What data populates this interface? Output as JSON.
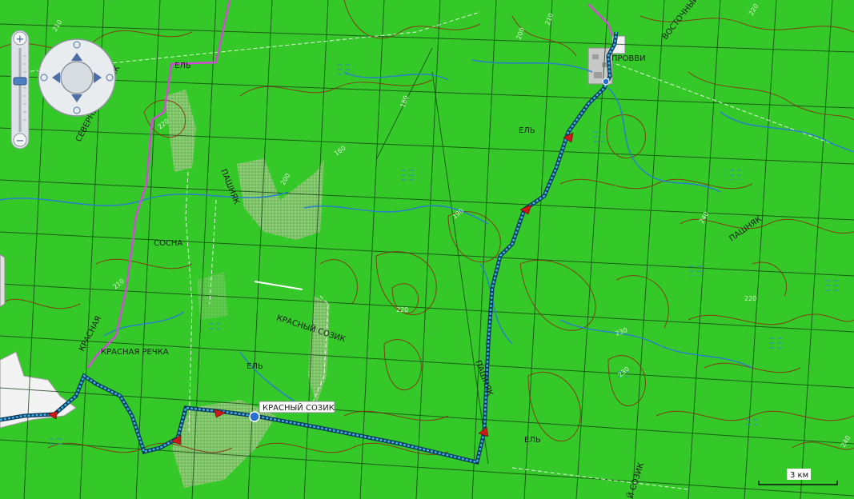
{
  "map": {
    "background_color": "#34c928",
    "route_color": "#1f9ad6",
    "road_color": "#d24bd6",
    "contour_color": "#8a2a10"
  },
  "places": {
    "provvi": "ПРОВВИ",
    "vostochny": "ВОСТОЧНЫЙ",
    "krasny_sozik": "КРАСНЫЙ СОЗИК",
    "krasny_sozik_river": "КРАСНЫЙ СОЗИК",
    "krasnaya_rechka": "КРАСНАЯ РЕЧКА",
    "krasnaya": "КРАСНАЯ",
    "sosna": "СОСНА",
    "el_1": "ЕЛЬ",
    "el_2": "ЕЛЬ",
    "el_3": "ЕЛЬ",
    "el_4": "ЕЛЬ",
    "pashnyak_1": "ПАШНЯК",
    "pashnyak_2": "ПАШНЯК",
    "pashnyak_3": "ПАШНЯК",
    "sozik_bottom": "Й СОЗИК",
    "severny": "СЕВЕРНЫЙ ПАШНЯК"
  },
  "contour_labels": [
    "210",
    "220",
    "200",
    "160",
    "180",
    "190",
    "200",
    "210",
    "220",
    "240",
    "220",
    "230",
    "220",
    "230",
    "240",
    "210"
  ],
  "controls": {
    "zoom_in": "+",
    "zoom_out": "−",
    "pan_up": "▲",
    "pan_down": "▼",
    "pan_left": "◀",
    "pan_right": "▶"
  },
  "scale": {
    "label": "3 км"
  }
}
